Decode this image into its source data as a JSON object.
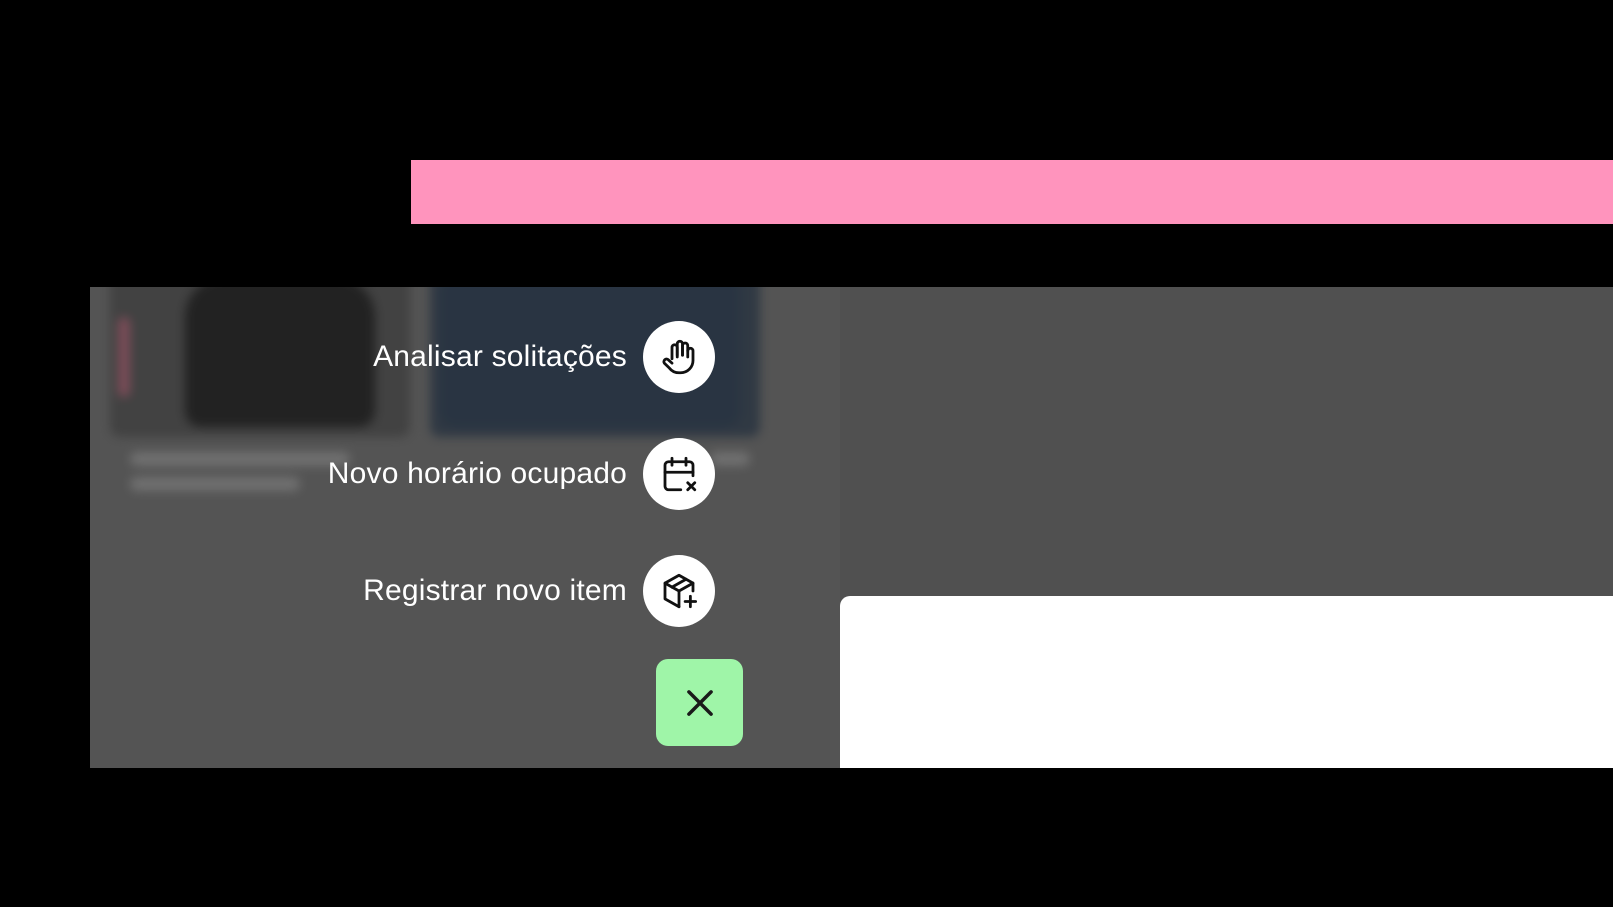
{
  "header": {
    "accent_color": "#ff94bd"
  },
  "fab_menu": {
    "items": [
      {
        "label": "Analisar solitações",
        "icon": "hand-icon"
      },
      {
        "label": "Novo horário ocupado",
        "icon": "calendar-x-icon"
      },
      {
        "label": "Registrar novo item",
        "icon": "package-plus-icon"
      }
    ],
    "close_icon": "close-icon",
    "close_color": "#9ff5a8"
  }
}
